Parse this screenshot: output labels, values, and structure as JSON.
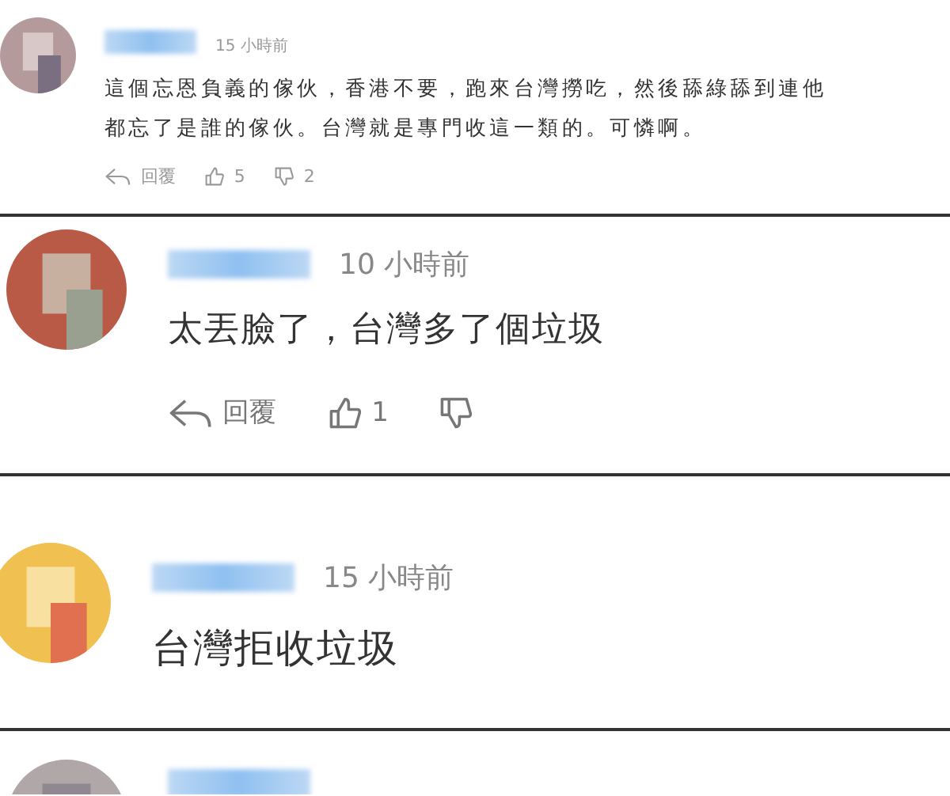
{
  "comments": [
    {
      "kind": "compact",
      "time": "15 小時前",
      "text": [
        "這個忘恩負義的傢伙，香港不要，跑來台灣撈吃，然後舔綠舔到連他",
        "都忘了是誰的傢伙。台灣就是專門收這一類的。可憐啊。"
      ],
      "reply": "回覆",
      "likes": "5",
      "dislikes": "2"
    },
    {
      "kind": "regular",
      "time": "10 小時前",
      "text": [
        "太丟臉了，台灣多了個垃圾"
      ],
      "reply": "回覆",
      "likes": "1"
    },
    {
      "kind": "regular",
      "time": "15 小時前",
      "text": [
        "台灣拒收垃圾"
      ]
    },
    {
      "kind": "regular"
    }
  ]
}
